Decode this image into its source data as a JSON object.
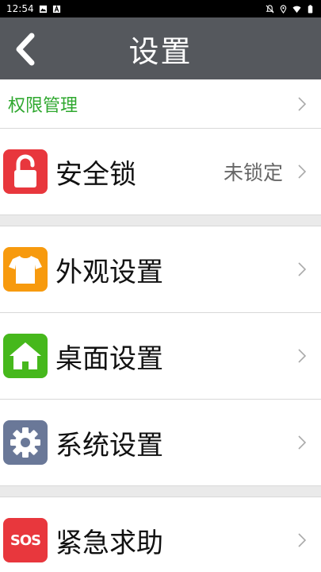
{
  "status_bar": {
    "time": "12:54",
    "left_icons": [
      "image-icon",
      "a-badge-icon"
    ],
    "right_icons": [
      "notifications-off-icon",
      "location-icon",
      "wifi-icon",
      "battery-icon"
    ]
  },
  "header": {
    "title": "设置",
    "back_icon": "chevron-left-icon",
    "background": "#55585d"
  },
  "permissions": {
    "label": "权限管理",
    "color": "#2fa82f"
  },
  "items": [
    {
      "label": "安全锁",
      "value": "未锁定",
      "icon": "lock-icon",
      "color": "#e8373d"
    },
    {
      "label": "外观设置",
      "value": "",
      "icon": "tshirt-icon",
      "color": "#f79a0e"
    },
    {
      "label": "桌面设置",
      "value": "",
      "icon": "home-icon",
      "color": "#46b81c"
    },
    {
      "label": "系统设置",
      "value": "",
      "icon": "gear-icon",
      "color": "#6a7898"
    },
    {
      "label": "紧急求助",
      "value": "",
      "icon": "sos-icon",
      "icon_text": "SOS",
      "color": "#e8373d"
    }
  ]
}
